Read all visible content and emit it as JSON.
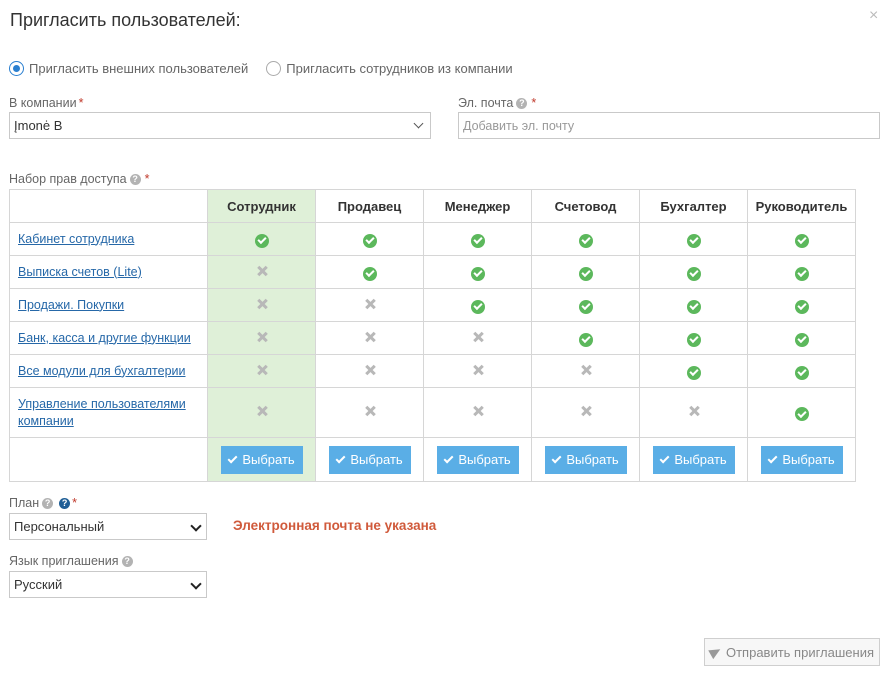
{
  "dialog": {
    "title": "Пригласить пользователей:",
    "close_label": "×"
  },
  "invite_type": {
    "options": [
      {
        "label": "Пригласить внешних пользователей",
        "checked": true
      },
      {
        "label": "Пригласить сотрудников из компании",
        "checked": false
      }
    ]
  },
  "company": {
    "label": "В компании",
    "value": "Įmonė B"
  },
  "email": {
    "label": "Эл. почта",
    "placeholder": "Добавить эл. почту",
    "value": ""
  },
  "access": {
    "label": "Набор прав доступа",
    "roles": [
      "Сотрудник",
      "Продавец",
      "Менеджер",
      "Счетовод",
      "Бухгалтер",
      "Руководитель"
    ],
    "selected_role_index": 0,
    "rows": [
      {
        "name": "Кабинет сотрудника",
        "perms": [
          true,
          true,
          true,
          true,
          true,
          true
        ]
      },
      {
        "name": "Выписка счетов (Lite)",
        "perms": [
          false,
          true,
          true,
          true,
          true,
          true
        ]
      },
      {
        "name": "Продажи. Покупки",
        "perms": [
          false,
          false,
          true,
          true,
          true,
          true
        ]
      },
      {
        "name": "Банк, касса и другие функции",
        "perms": [
          false,
          false,
          false,
          true,
          true,
          true
        ]
      },
      {
        "name": "Все модули для бухгалтерии",
        "perms": [
          false,
          false,
          false,
          false,
          true,
          true
        ]
      },
      {
        "name": "Управление пользователями компании",
        "perms": [
          false,
          false,
          false,
          false,
          false,
          true
        ]
      }
    ],
    "select_button_label": "Выбрать"
  },
  "plan": {
    "label": "План",
    "value": "Персональный"
  },
  "error_message": "Электронная почта не указана",
  "language": {
    "label": "Язык приглашения",
    "value": "Русский"
  },
  "send_button_label": "Отправить приглашения",
  "colors": {
    "accent_blue": "#5aaee6",
    "link": "#2668a8",
    "check_green": "#5cb85c",
    "highlight": "#dff0d8",
    "error": "#d05a3b",
    "required": "#c0392b"
  }
}
